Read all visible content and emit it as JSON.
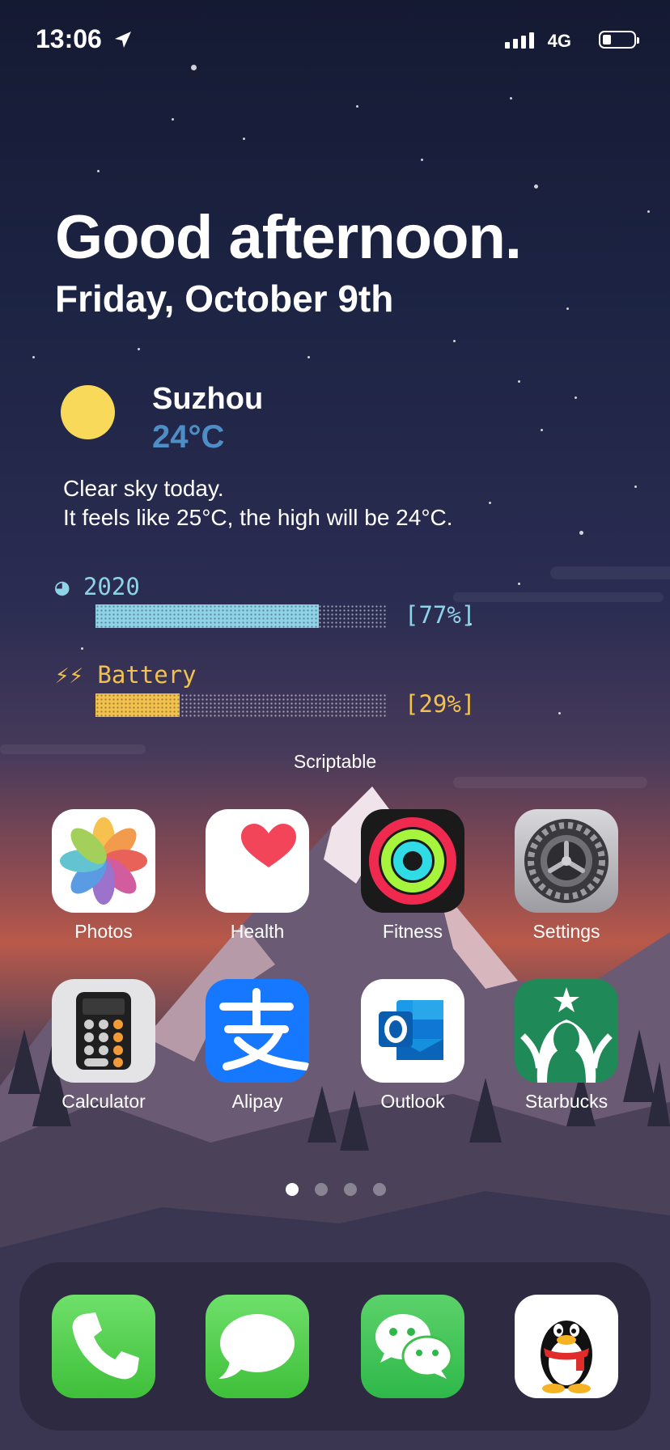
{
  "status_bar": {
    "time": "13:06",
    "network": "4G"
  },
  "widget": {
    "greeting": "Good afternoon.",
    "date": "Friday, October 9th",
    "weather": {
      "city": "Suzhou",
      "temperature": "24°C",
      "line1": "Clear sky today.",
      "line2": "It feels like 25°C, the high will be 24°C."
    },
    "year_progress": {
      "icon": "◕",
      "label": "2020",
      "percent": 77,
      "percent_text": "[77%]",
      "color": "#8fd3e8"
    },
    "battery_progress": {
      "icon": "⚡⚡",
      "label": "Battery",
      "percent": 29,
      "percent_text": "[29%]",
      "color": "#f2c14e"
    },
    "title": "Scriptable"
  },
  "apps": [
    {
      "label": "Photos"
    },
    {
      "label": "Health"
    },
    {
      "label": "Fitness"
    },
    {
      "label": "Settings"
    },
    {
      "label": "Calculator"
    },
    {
      "label": "Alipay"
    },
    {
      "label": "Outlook"
    },
    {
      "label": "Starbucks"
    }
  ],
  "page_dots": {
    "count": 4,
    "active": 1
  },
  "dock": [
    "phone-icon",
    "messages-icon",
    "wechat-icon",
    "qq-icon"
  ]
}
